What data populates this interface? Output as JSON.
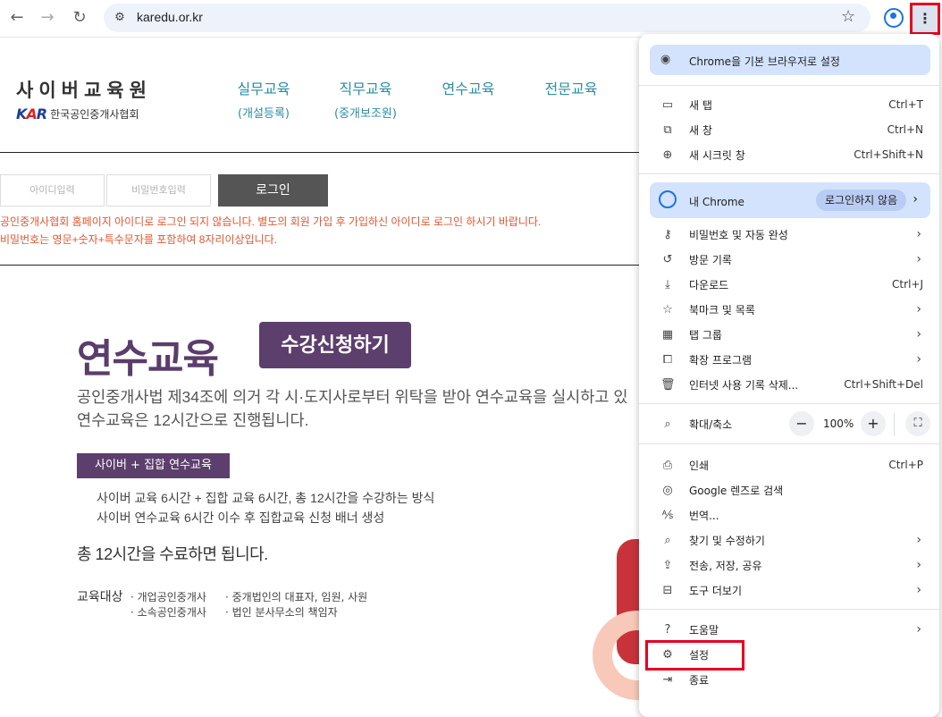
{
  "browser": {
    "url": "karedu.or.kr",
    "icons": {
      "back": "arrow-left-icon",
      "forward": "arrow-right-icon",
      "reload": "reload-icon",
      "site_info": "tune-icon",
      "bookmark": "star-icon",
      "profile": "profile-icon",
      "menu": "more-vert-icon"
    }
  },
  "site": {
    "brand_title": "사이버교육원",
    "brand_logo_text": "한국공인중개사협회",
    "logo_letters": "KAR",
    "nav": [
      {
        "main": "실무교육",
        "sub": "(개설등록)"
      },
      {
        "main": "직무교육",
        "sub": "(중개보조원)"
      },
      {
        "main": "연수교육",
        "sub": ""
      },
      {
        "main": "전문교육",
        "sub": ""
      }
    ],
    "login": {
      "id_placeholder": "아이디입력",
      "pw_placeholder": "비밀번호입력",
      "button": "로그인",
      "warning1": "공인중개사협회 홈페이지 아이디로 로그인 되지 않습니다. 별도의 회원 가입 후 가입하신 아이디로 로그인 하시기 바랍니다.",
      "warning2": "비밀번호는 영문+숫자+특수문자를 포함하여 8자리이상입니다."
    },
    "hero": {
      "title": "연수교육",
      "enroll_button": "수강신청하기",
      "desc1": "공인중개사법 제34조에 의거 각 시·도지사로부터 위탁을 받아 연수교육을 실시하고 있",
      "desc2": "연수교육은 12시간으로 진행됩니다.",
      "tag": "사이버 + 집합 연수교육",
      "bullet1": "사이버 교육 6시간 + 집합 교육 6시간, 총 12시간을 수강하는 방식",
      "bullet2": "사이버 연수교육 6시간 이수 후 집합교육 신청 배너 생성",
      "complete": "총 12시간을 수료하면 됩니다.",
      "target_label": "교육대상",
      "targets": [
        "개업공인중개사",
        "소속공인중개사",
        "중개법인의 대표자, 임원, 사원",
        "법인 분사무소의 책임자"
      ]
    }
  },
  "menu": {
    "set_default": "Chrome을 기본 브라우저로 설정",
    "new_tab": {
      "label": "새 탭",
      "shortcut": "Ctrl+T"
    },
    "new_window": {
      "label": "새 창",
      "shortcut": "Ctrl+N"
    },
    "incognito": {
      "label": "새 시크릿 창",
      "shortcut": "Ctrl+Shift+N"
    },
    "my_chrome": {
      "label": "내 Chrome",
      "chip": "로그인하지 않음"
    },
    "passwords": {
      "label": "비밀번호 및 자동 완성"
    },
    "history": {
      "label": "방문 기록"
    },
    "downloads": {
      "label": "다운로드",
      "shortcut": "Ctrl+J"
    },
    "bookmarks": {
      "label": "북마크 및 목록"
    },
    "tab_groups": {
      "label": "탭 그룹"
    },
    "extensions": {
      "label": "확장 프로그램"
    },
    "clear_data": {
      "label": "인터넷 사용 기록 삭제...",
      "shortcut": "Ctrl+Shift+Del"
    },
    "zoom": {
      "label": "확대/축소",
      "minus": "−",
      "value": "100%",
      "plus": "+"
    },
    "print": {
      "label": "인쇄",
      "shortcut": "Ctrl+P"
    },
    "google_lens": {
      "label": "Google 렌즈로 검색"
    },
    "translate": {
      "label": "번역..."
    },
    "find_edit": {
      "label": "찾기 및 수정하기"
    },
    "cast_save": {
      "label": "전송, 저장, 공유"
    },
    "more_tools": {
      "label": "도구 더보기"
    },
    "help": {
      "label": "도움말"
    },
    "settings": {
      "label": "설정"
    },
    "exit": {
      "label": "종료"
    }
  }
}
